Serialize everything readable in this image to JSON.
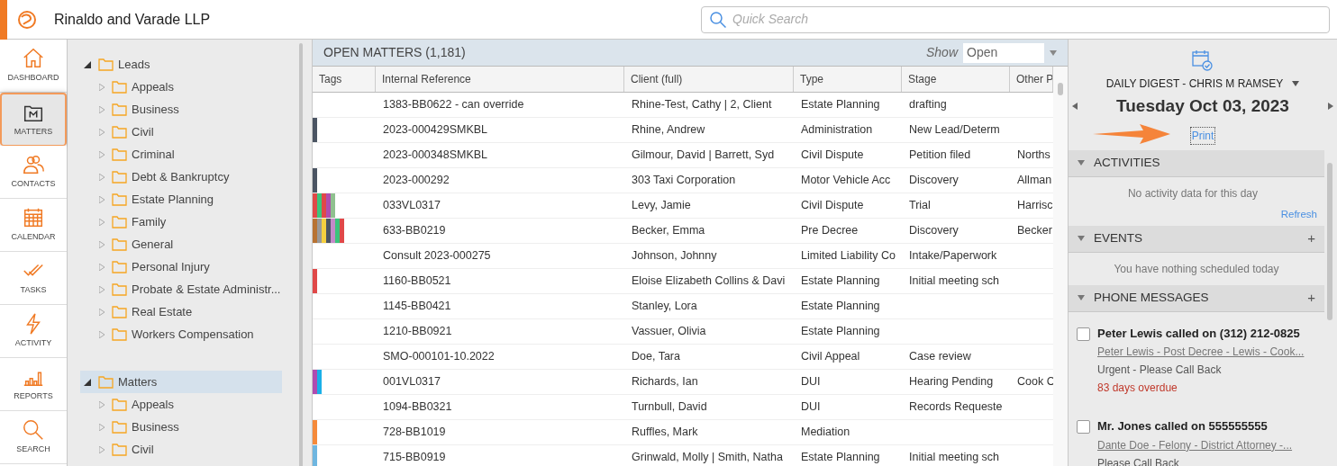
{
  "header": {
    "firm_name": "Rinaldo and Varade LLP",
    "search": {
      "placeholder": "Quick Search"
    }
  },
  "nav": [
    {
      "kind": "home",
      "label": "DASHBOARD",
      "selected": false
    },
    {
      "kind": "matters",
      "label": "MATTERS",
      "selected": true
    },
    {
      "kind": "contacts",
      "label": "CONTACTS",
      "selected": false
    },
    {
      "kind": "calendar",
      "label": "CALENDAR",
      "selected": false
    },
    {
      "kind": "tasks",
      "label": "TASKS",
      "selected": false
    },
    {
      "kind": "activity",
      "label": "ACTIVITY",
      "selected": false
    },
    {
      "kind": "reports",
      "label": "REPORTS",
      "selected": false
    },
    {
      "kind": "search",
      "label": "SEARCH",
      "selected": false
    }
  ],
  "tree": [
    {
      "label": "Leads",
      "expanded": true,
      "selected": false,
      "children": [
        {
          "label": "Appeals",
          "expanded": false,
          "selected": false
        },
        {
          "label": "Business",
          "expanded": false,
          "selected": false
        },
        {
          "label": "Civil",
          "expanded": false,
          "selected": false
        },
        {
          "label": "Criminal",
          "expanded": false,
          "selected": false
        },
        {
          "label": "Debt & Bankruptcy",
          "expanded": false,
          "selected": false
        },
        {
          "label": "Estate Planning",
          "expanded": false,
          "selected": false
        },
        {
          "label": "Family",
          "expanded": false,
          "selected": false
        },
        {
          "label": "General",
          "expanded": false,
          "selected": false
        },
        {
          "label": "Personal Injury",
          "expanded": false,
          "selected": false
        },
        {
          "label": "Probate & Estate Administr...",
          "expanded": false,
          "selected": false
        },
        {
          "label": "Real Estate",
          "expanded": false,
          "selected": false
        },
        {
          "label": "Workers Compensation",
          "expanded": false,
          "selected": false
        }
      ]
    },
    {
      "label": "Matters",
      "expanded": true,
      "selected": true,
      "children": [
        {
          "label": "Appeals",
          "expanded": false,
          "selected": false
        },
        {
          "label": "Business",
          "expanded": false,
          "selected": false
        },
        {
          "label": "Civil",
          "expanded": false,
          "selected": false
        }
      ]
    }
  ],
  "matters": {
    "title": "OPEN MATTERS (1,181)",
    "show_label": "Show",
    "show_value": "Open",
    "tags_column": "Tags",
    "columns": [
      "Internal Reference",
      "Client (full)",
      "Type",
      "Stage",
      "Other P"
    ],
    "rows": [
      {
        "tags": [],
        "cells": [
          "1383-BB0622 - can override",
          "Rhine-Test, Cathy | 2, Client",
          "Estate Planning",
          "drafting",
          ""
        ]
      },
      {
        "tags": [
          {
            "color": "#4b5563"
          }
        ],
        "cells": [
          "2023-000429SMKBL",
          "Rhine, Andrew",
          "Administration",
          "New Lead/Determ",
          ""
        ]
      },
      {
        "tags": [],
        "cells": [
          "2023-000348SMKBL",
          "Gilmour, David | Barrett, Syd",
          "Civil Dispute",
          "Petition filed",
          "Norths"
        ]
      },
      {
        "tags": [
          {
            "color": "#4b5563"
          }
        ],
        "cells": [
          "2023-000292",
          "303 Taxi Corporation",
          "Motor Vehicle Acc",
          "Discovery",
          "Allman"
        ]
      },
      {
        "tags": [
          {
            "color": "#e04848"
          },
          {
            "color": "#3cc47c"
          },
          {
            "color": "#e04848"
          },
          {
            "color": "#b04cb0"
          },
          {
            "color": "#8fc08f"
          }
        ],
        "cells": [
          "033VL0317",
          "Levy, Jamie",
          "Civil Dispute",
          "Trial",
          "Harrisc"
        ]
      },
      {
        "tags": [
          {
            "color": "#b87333"
          },
          {
            "color": "#999999"
          },
          {
            "color": "#f5d040"
          },
          {
            "color": "#4b5563"
          },
          {
            "color": "#c48ac8"
          },
          {
            "color": "#3cc47c"
          },
          {
            "color": "#e04848"
          }
        ],
        "cells": [
          "633-BB0219",
          "Becker, Emma",
          "Pre Decree",
          "Discovery",
          "Becker"
        ]
      },
      {
        "tags": [],
        "cells": [
          "Consult 2023-000275",
          "Johnson, Johnny",
          "Limited Liability Co",
          "Intake/Paperwork",
          ""
        ]
      },
      {
        "tags": [
          {
            "color": "#e04848"
          }
        ],
        "cells": [
          "1160-BB0521",
          "Eloise Elizabeth Collins & Davi",
          "Estate Planning",
          "Initial meeting sch",
          ""
        ]
      },
      {
        "tags": [],
        "cells": [
          "1145-BB0421",
          "Stanley, Lora",
          "Estate Planning",
          "",
          ""
        ]
      },
      {
        "tags": [],
        "cells": [
          "1210-BB0921",
          "Vassuer, Olivia",
          "Estate Planning",
          "",
          ""
        ]
      },
      {
        "tags": [],
        "cells": [
          "SMO-000101-10.2022",
          "Doe, Tara",
          "Civil Appeal",
          "Case review",
          ""
        ]
      },
      {
        "tags": [
          {
            "color": "#b04cb0"
          },
          {
            "color": "#1ab0e8"
          }
        ],
        "cells": [
          "001VL0317",
          "Richards, Ian",
          "DUI",
          "Hearing Pending",
          "Cook C"
        ]
      },
      {
        "tags": [],
        "cells": [
          "1094-BB0321",
          "Turnbull, David",
          "DUI",
          "Records Requeste",
          ""
        ]
      },
      {
        "tags": [
          {
            "color": "#f58a3a"
          }
        ],
        "cells": [
          "728-BB1019",
          "Ruffles, Mark",
          "Mediation",
          "",
          ""
        ]
      },
      {
        "tags": [
          {
            "color": "#6fb6e0"
          }
        ],
        "cells": [
          "715-BB0919",
          "Grinwald, Molly | Smith, Natha",
          "Estate Planning",
          "Initial meeting sch",
          ""
        ]
      }
    ]
  },
  "digest": {
    "title": "DAILY DIGEST - CHRIS M RAMSEY",
    "date": "Tuesday Oct 03, 2023",
    "print": "Print",
    "activities": {
      "title": "ACTIVITIES",
      "expanded": true,
      "empty": "No activity data for this day",
      "refresh": "Refresh"
    },
    "events": {
      "title": "EVENTS",
      "expanded": true,
      "add": "+",
      "empty": "You have nothing scheduled today"
    },
    "phone_messages": {
      "title": "PHONE MESSAGES",
      "expanded": true,
      "add": "+",
      "items": [
        {
          "checked": false,
          "title": "Peter Lewis called on (312) 212-0825",
          "matter": "Peter Lewis - Post Decree - Lewis - Cook...",
          "note": "Urgent - Please Call Back",
          "overdue": "83 days overdue"
        },
        {
          "checked": false,
          "title": "Mr. Jones called on 555555555",
          "matter": "Dante Doe - Felony - District Attorney -...",
          "note": "Please Call Back"
        }
      ]
    }
  }
}
